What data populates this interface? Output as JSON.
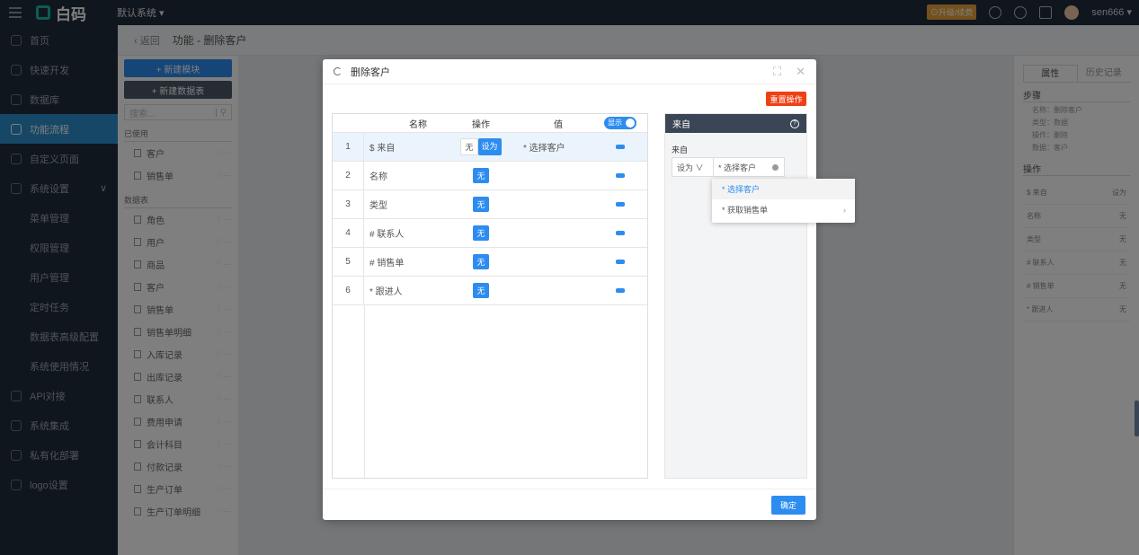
{
  "topbar": {
    "logo": "白码",
    "system": "默认系统 ▾",
    "upgrade": "⊙升级/续费",
    "user": "sen666 ▾"
  },
  "sidebar": {
    "items": [
      "首页",
      "快速开发",
      "数据库",
      "功能流程",
      "自定义页面",
      "系统设置"
    ],
    "sub": [
      "菜单管理",
      "权限管理",
      "用户管理",
      "定时任务",
      "数据表高级配置",
      "系统使用情况"
    ],
    "more": [
      "API对接",
      "系统集成",
      "私有化部署",
      "logo设置"
    ]
  },
  "crumb": {
    "back": "‹ 返回",
    "title": "功能 - 删除客户"
  },
  "modules": {
    "new_module": "+ 新建模块",
    "new_table": "+ 新建数据表",
    "search_placeholder": "搜索...",
    "used_group": "已使用",
    "used": [
      "客户",
      "销售单"
    ],
    "tables_group": "数据表",
    "tables": [
      "角色",
      "用户",
      "商品",
      "客户",
      "销售单",
      "销售单明细",
      "入库记录",
      "出库记录",
      "联系人",
      "费用申请",
      "会计科目",
      "付款记录",
      "生产订单",
      "生产订单明细"
    ]
  },
  "props": {
    "tab1": "属性",
    "tab2": "历史记录",
    "step": "步骤",
    "lines": [
      "名称：删除客户",
      "类型：数据",
      "操作：删除",
      "数据：客户"
    ],
    "ops_title": "操作",
    "ops": [
      {
        "k": "$ 来自",
        "v": "设为"
      },
      {
        "k": "名称",
        "v": "无"
      },
      {
        "k": "类型",
        "v": "无"
      },
      {
        "k": "# 联系人",
        "v": "无"
      },
      {
        "k": "# 销售单",
        "v": "无"
      },
      {
        "k": "* 跟进人",
        "v": "无"
      }
    ]
  },
  "dialog": {
    "title": "删除客户",
    "reset": "重置操作",
    "headers": {
      "name": "名称",
      "op": "操作",
      "val": "值",
      "show": "显示"
    },
    "rows": [
      {
        "i": "1",
        "name": "$ 来自",
        "val": "* 选择客户"
      },
      {
        "i": "2",
        "name": "名称",
        "val": ""
      },
      {
        "i": "3",
        "name": "类型",
        "val": ""
      },
      {
        "i": "4",
        "name": "# 联系人",
        "val": ""
      },
      {
        "i": "5",
        "name": "# 销售单",
        "val": ""
      },
      {
        "i": "6",
        "name": "* 跟进人",
        "val": ""
      }
    ],
    "op_none": "无",
    "op_set": "设为",
    "panel": {
      "title": "来自",
      "label": "来自",
      "mode": "设为 ∨",
      "value": "* 选择客户"
    },
    "options": [
      "* 选择客户",
      "* 获取销售单"
    ],
    "ok": "确定"
  }
}
